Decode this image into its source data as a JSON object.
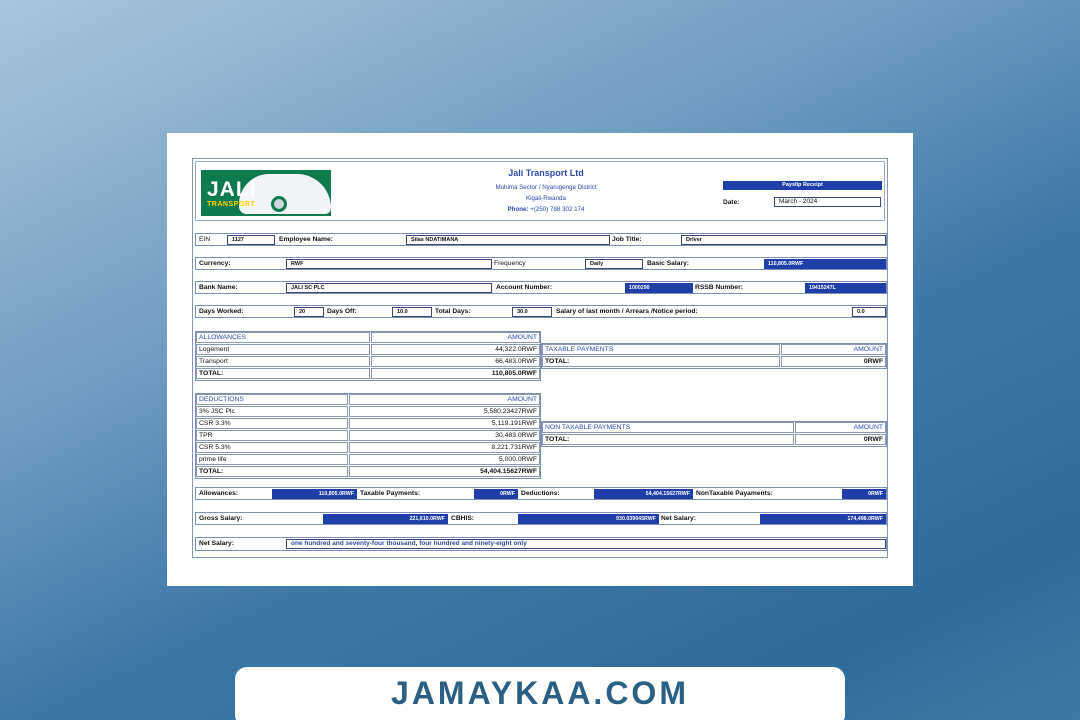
{
  "company": {
    "name": "Jali Transport Ltd",
    "address1": "Muhima Sector / Nyarugenge District",
    "address2": "Kigali-Rwanda",
    "phone_label": "Phone:",
    "phone": "+(250) 788 302 174"
  },
  "logo": {
    "main": "JALI",
    "sub": "TRANSPORT"
  },
  "receipt": {
    "title": "Payslip Receipt",
    "date_label": "Date:",
    "date": "March - 2024"
  },
  "employee": {
    "ein_label": "EIN",
    "ein": "1127",
    "name_label": "Employee Name:",
    "name": "Silas NDATIMANA",
    "job_label": "Job Title:",
    "job": "Driver"
  },
  "pay": {
    "currency_label": "Currency:",
    "currency": "RWF",
    "frequency_label": "Frequency",
    "frequency": "Daily",
    "basic_label": "Basic Salary:",
    "basic": "110,805.0RWF"
  },
  "bank": {
    "name_label": "Bank Name:",
    "name": "JALI SC PLC",
    "acct_label": "Account Number:",
    "acct": "1000290",
    "rssb_label": "RSSB Number:",
    "rssb": "19415247L"
  },
  "days": {
    "worked_label": "Days Worked:",
    "worked": "20",
    "off_label": "Days Off:",
    "off": "10.0",
    "total_label": "Total Days:",
    "total": "30.0",
    "arrears_label": "Salary of last month / Arrears /Notice period:",
    "arrears": "0.0"
  },
  "allowances": {
    "title": "ALLOWANCES",
    "amount_label": "AMOUNT",
    "rows": [
      {
        "item": "Logement",
        "amount": "44,322.0RWF"
      },
      {
        "item": "Transport",
        "amount": "66,483.0RWF"
      }
    ],
    "total_label": "TOTAL:",
    "total": "110,805.0RWF"
  },
  "taxable": {
    "title": "TAXABLE PAYMENTS",
    "amount_label": "AMOUNT",
    "total_label": "TOTAL:",
    "total": "0RWF"
  },
  "deductions": {
    "title": "DEDUCTIONS",
    "amount_label": "AMOUNT",
    "rows": [
      {
        "item": "3% JSC Plc",
        "amount": "5,580.23427RWF"
      },
      {
        "item": "CSR 3.3%",
        "amount": "5,119.191RWF"
      },
      {
        "item": "TPR",
        "amount": "30,483.0RWF"
      },
      {
        "item": "CSR 5.3%",
        "amount": "8,221.731RWF"
      },
      {
        "item": "prime life",
        "amount": "5,000.0RWF"
      }
    ],
    "total_label": "TOTAL:",
    "total": "54,404.15627RWF"
  },
  "nontaxable": {
    "title": "NON TAXABLE PAYMENTS",
    "amount_label": "AMOUNT",
    "total_label": "TOTAL:",
    "total": "0RWF"
  },
  "summary": {
    "allow_label": "Allowances:",
    "allow": "110,805.0RWF",
    "tax_label": "Taxable Payments:",
    "tax": "0RWF",
    "ded_label": "Deductions:",
    "ded": "54,404.15627RWF",
    "nontax_label": "NonTaxable Payaments:",
    "nontax": "0RWF"
  },
  "gross": {
    "gross_label": "Gross Salary:",
    "gross": "221,610.0RWF",
    "cbhis_label": "CBHIS:",
    "cbhis": "930.039045RWF",
    "net_label": "Net Salary:",
    "net": "174,498.0RWF"
  },
  "words": {
    "label": "Net Salary:",
    "text": "one hundred and seventy-four thousand, four hundred and ninety-eight only"
  },
  "footer": {
    "site": "JAMAYKAA.COM"
  }
}
